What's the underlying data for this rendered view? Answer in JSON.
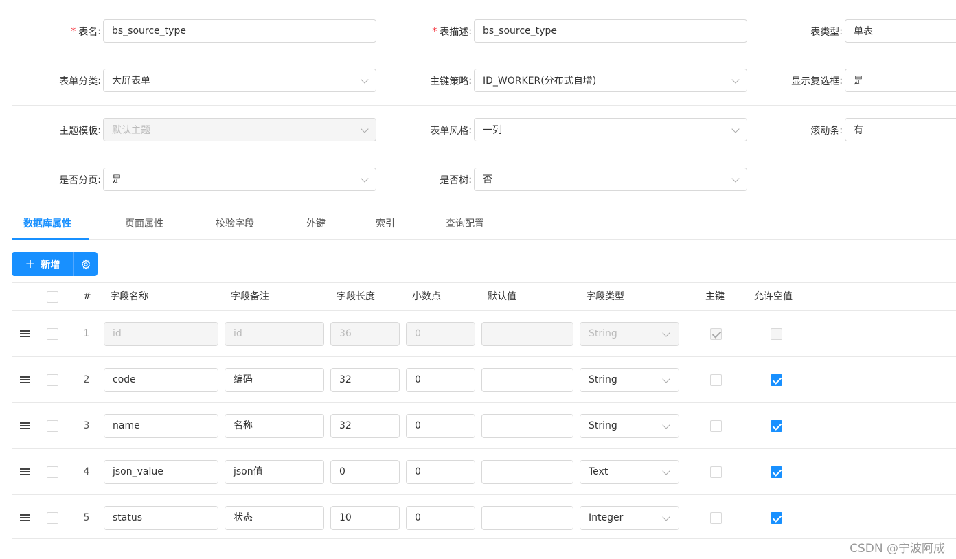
{
  "form": {
    "table_name": {
      "label": "表名",
      "value": "bs_source_type",
      "required": true
    },
    "table_desc": {
      "label": "表描述",
      "value": "bs_source_type",
      "required": true
    },
    "table_type": {
      "label": "表类型",
      "value": "单表"
    },
    "form_category": {
      "label": "表单分类",
      "value": "大屏表单"
    },
    "pk_strategy": {
      "label": "主键策略",
      "value": "ID_WORKER(分布式自增)"
    },
    "show_checkbox": {
      "label": "显示复选框",
      "value": "是"
    },
    "theme_template": {
      "label": "主题模板",
      "value": "默认主题"
    },
    "form_style": {
      "label": "表单风格",
      "value": "一列"
    },
    "scrollbar": {
      "label": "滚动条",
      "value": "有"
    },
    "paginate": {
      "label": "是否分页",
      "value": "是"
    },
    "is_tree": {
      "label": "是否树",
      "value": "否"
    }
  },
  "colon": ":",
  "required_mark": "*",
  "tabs": [
    "数据库属性",
    "页面属性",
    "校验字段",
    "外键",
    "索引",
    "查询配置"
  ],
  "toolbar": {
    "add_label": "新增"
  },
  "grid": {
    "headers": {
      "index": "#",
      "field_name": "字段名称",
      "field_comment": "字段备注",
      "field_length": "字段长度",
      "decimal": "小数点",
      "default_value": "默认值",
      "field_type": "字段类型",
      "primary_key": "主键",
      "nullable": "允许空值"
    },
    "rows": [
      {
        "index": "1",
        "name": "id",
        "comment": "id",
        "length": "36",
        "decimal": "0",
        "default": "",
        "type": "String",
        "pk": true,
        "nullable": false,
        "disabled": true
      },
      {
        "index": "2",
        "name": "code",
        "comment": "编码",
        "length": "32",
        "decimal": "0",
        "default": "",
        "type": "String",
        "pk": false,
        "nullable": true,
        "disabled": false
      },
      {
        "index": "3",
        "name": "name",
        "comment": "名称",
        "length": "32",
        "decimal": "0",
        "default": "",
        "type": "String",
        "pk": false,
        "nullable": true,
        "disabled": false
      },
      {
        "index": "4",
        "name": "json_value",
        "comment": "json值",
        "length": "0",
        "decimal": "0",
        "default": "",
        "type": "Text",
        "pk": false,
        "nullable": true,
        "disabled": false
      },
      {
        "index": "5",
        "name": "status",
        "comment": "状态",
        "length": "10",
        "decimal": "0",
        "default": "",
        "type": "Integer",
        "pk": false,
        "nullable": true,
        "disabled": false
      }
    ]
  },
  "watermark": "CSDN @宁波阿成",
  "colors": {
    "primary": "#1890ff",
    "required": "#f5222d",
    "border": "#d9d9d9"
  },
  "icons": {
    "add": "plus-icon",
    "settings": "gear-icon",
    "drag": "drag-handle-icon",
    "dropdown": "chevron-down-icon"
  }
}
